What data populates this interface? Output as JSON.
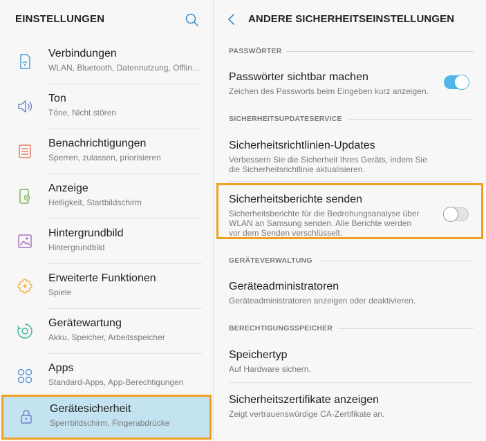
{
  "left": {
    "title": "EINSTELLUNGEN",
    "items": [
      {
        "title": "Verbindungen",
        "sub": "WLAN, Bluetooth, Datennutzung, Offline…",
        "icon": "connections-icon",
        "color": "#4f9fd5"
      },
      {
        "title": "Ton",
        "sub": "Töne, Nicht stören",
        "icon": "speaker-icon",
        "color": "#6e86c9"
      },
      {
        "title": "Benachrichtigungen",
        "sub": "Sperren, zulassen, priorisieren",
        "icon": "notifications-icon",
        "color": "#e57a62"
      },
      {
        "title": "Anzeige",
        "sub": "Helligkeit, Startbildschirm",
        "icon": "display-icon",
        "color": "#7cb35f"
      },
      {
        "title": "Hintergrundbild",
        "sub": "Hintergrundbild",
        "icon": "wallpaper-icon",
        "color": "#a772c2"
      },
      {
        "title": "Erweiterte Funktionen",
        "sub": "Spiele",
        "icon": "advanced-features-icon",
        "color": "#f2b23e"
      },
      {
        "title": "Gerätewartung",
        "sub": "Akku, Speicher, Arbeitsspeicher",
        "icon": "device-care-icon",
        "color": "#3fb79a"
      },
      {
        "title": "Apps",
        "sub": "Standard-Apps, App-Berechtigungen",
        "icon": "apps-icon",
        "color": "#5a8fd6"
      },
      {
        "title": "Gerätesicherheit",
        "sub": "Sperrbildschirm, Fingerabdrücke",
        "icon": "lock-icon",
        "color": "#6f7fcf",
        "selected": true
      }
    ]
  },
  "right": {
    "title": "ANDERE SICHERHEITSEINSTELLUNGEN",
    "sections": {
      "passwords": "PASSWÖRTER",
      "security_update": "SICHERHEITSUPDATESERVICE",
      "device_admin": "GERÄTEVERWALTUNG",
      "credential_storage": "BERECHTIGUNGSSPEICHER"
    },
    "rows": {
      "show_passwords": {
        "title": "Passwörter sichtbar machen",
        "sub": "Zeichen des Passworts beim Eingeben kurz anzeigen.",
        "toggle": true
      },
      "policy_updates": {
        "title": "Sicherheitsrichtlinien-Updates",
        "sub": "Verbessern Sie die Sicherheit Ihres Geräts, indem Sie die Sicherheitsrichtlinie aktualisieren."
      },
      "send_reports": {
        "title": "Sicherheitsberichte senden",
        "sub": "Sicherheitsberichte für die Bedrohungsanalyse über WLAN an Samsung senden. Alle Berichte werden vor dem Senden verschlüsselt.",
        "toggle": false
      },
      "device_admins": {
        "title": "Geräteadministratoren",
        "sub": "Geräteadministratoren anzeigen oder deaktivieren."
      },
      "storage_type": {
        "title": "Speichertyp",
        "sub": "Auf Hardware sichern."
      },
      "view_certs": {
        "title": "Sicherheitszertifikate anzeigen",
        "sub": "Zeigt vertrauenswürdige CA-Zertifikate an."
      }
    }
  },
  "colors": {
    "accent": "#4fb6e6",
    "highlight": "#f0a020",
    "selected_bg": "#c4e3f1"
  }
}
